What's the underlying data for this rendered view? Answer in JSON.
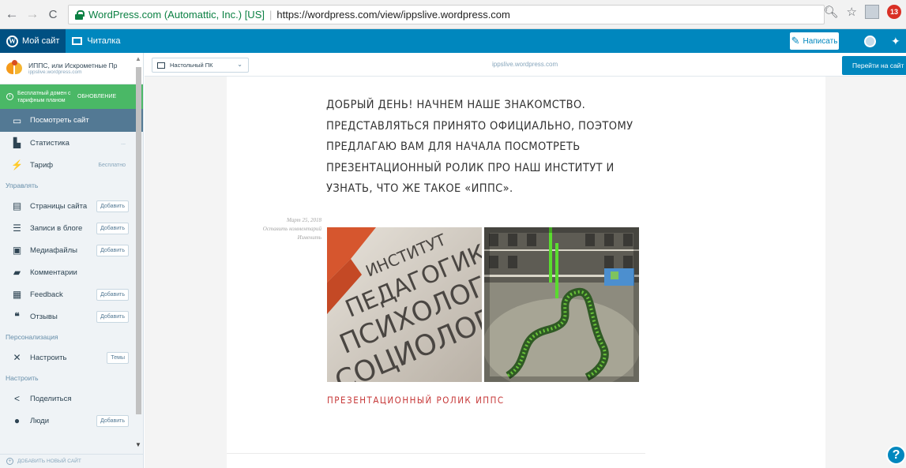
{
  "browser": {
    "back": "←",
    "forward": "→",
    "reload": "C",
    "secure_label": "WordPress.com (Automattic, Inc.) [US]",
    "separator": "|",
    "url": "https://wordpress.com/view/ippslive.wordpress.com",
    "ext_badge_count": "13"
  },
  "masterbar": {
    "my_site": "Мой сайт",
    "reader": "Читалка",
    "write": "Написать"
  },
  "sidebar": {
    "site_name": "ИППС, или Искрометные Пр",
    "site_url": "ippslive.wordpress.com",
    "upgrade_text": "Бесплатный домен с тарифным планом",
    "upgrade_cta": "ОБНОВЛЕНИЕ",
    "items": [
      {
        "label": "Посмотреть сайт"
      },
      {
        "label": "Статистика",
        "aside": "..."
      },
      {
        "label": "Тариф",
        "aside": "Бесплатно"
      }
    ],
    "section_manage": "Управлять",
    "manage": [
      {
        "label": "Страницы сайта",
        "button": "Добавить"
      },
      {
        "label": "Записи в блоге",
        "button": "Добавить"
      },
      {
        "label": "Медиафайлы",
        "button": "Добавить"
      },
      {
        "label": "Комментарии"
      },
      {
        "label": "Feedback",
        "button": "Добавить"
      },
      {
        "label": "Отзывы",
        "button": "Добавить"
      }
    ],
    "section_personal": "Персонализация",
    "personal": [
      {
        "label": "Настроить",
        "button": "Темы"
      }
    ],
    "section_configure": "Настроить",
    "configure": [
      {
        "label": "Поделиться"
      },
      {
        "label": "Люди",
        "button": "Добавить"
      }
    ],
    "add_site": "ДОБАВИТЬ НОВЫЙ САЙТ"
  },
  "preview_bar": {
    "device": "Настольный ПК",
    "url": "ippslive.wordpress.com",
    "visit": "Перейти на сайт"
  },
  "post": {
    "title": "ДОБРЫЙ ДЕНЬ! НАЧНЕМ НАШЕ ЗНАКОМСТВО. ПРЕДСТАВЛЯТЬСЯ ПРИНЯТО ОФИЦИАЛЬНО, ПОЭТОМУ ПРЕДЛАГАЮ ВАМ ДЛЯ НАЧАЛА ПОСМОТРЕТЬ ПРЕЗЕНТАЦИОННЫЙ РОЛИК ПРО НАШ ИНСТИТУТ И УЗНАТЬ, ЧТО ЖЕ ТАКОЕ «ИППС».",
    "date": "Март 25, 2018",
    "comment": "Оставить комментарий",
    "edit": "Изменить",
    "photo1_text": [
      "ИНСТИТУТ",
      "ПЕДАГОГИКИ",
      "ПСИХОЛОГИИ И",
      "СОЦИОЛОГИИ"
    ],
    "link": "ПРЕЗЕНТАЦИОННЫЙ РОЛИК ИППС"
  },
  "help": "?",
  "colors": {
    "wp_blue": "#0087be",
    "sidebar_selected": "#537994",
    "upgrade_green": "#4ab866",
    "link_red": "#c73a3a"
  }
}
